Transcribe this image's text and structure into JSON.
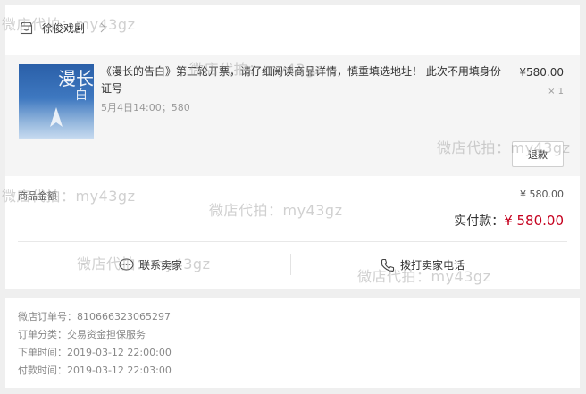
{
  "shop": {
    "name": "徐俊戏剧",
    "icon": "shop-icon"
  },
  "item": {
    "title": "《漫长的告白》第三轮开票，请仔细阅读商品详情，慎重填选地址！ 此次不用填身份证号",
    "price": "¥580.00",
    "qty": "× 1",
    "meta": "5月4日14:00；580",
    "refund_label": "退款",
    "thumb_title": "漫长",
    "thumb_sub": "白"
  },
  "summary": {
    "goods_total_label": "商品金额",
    "goods_total_value": "¥ 580.00",
    "paid_label": "实付款：",
    "paid_value": "¥ 580.00"
  },
  "actions": {
    "contact_label": "联系卖家",
    "call_label": "拨打卖家电话"
  },
  "order_info": {
    "order_no": "微店订单号：810666323065297",
    "category": "订单分类：交易资金担保服务",
    "order_time": "下单时间：2019-03-12 22:00:00",
    "pay_time": "付款时间：2019-03-12 22:03:00"
  },
  "watermark": {
    "text": "微店代拍：my43gz"
  },
  "colors": {
    "accent": "#c5001e",
    "background": "#efefef"
  }
}
